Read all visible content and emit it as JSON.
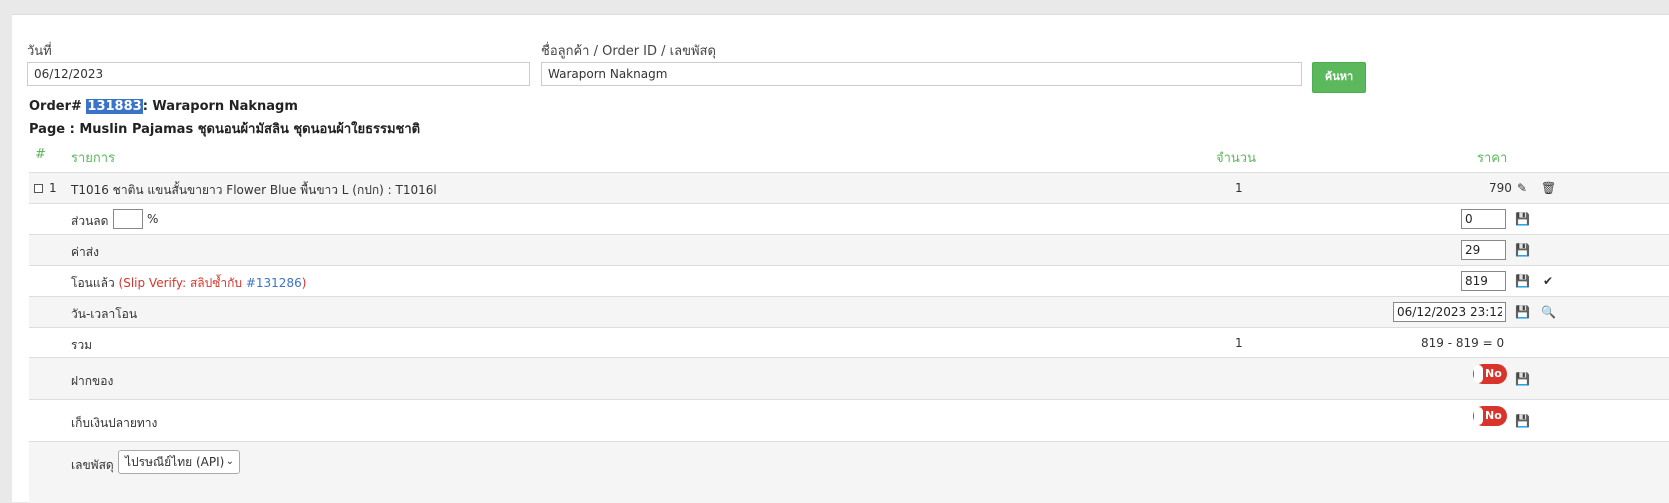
{
  "search": {
    "date_label": "วันที่",
    "date_value": "06/12/2023",
    "customer_label": "ชื่อลูกค้า / Order ID / เลขพัสดุ",
    "customer_value": "Waraporn Naknagm",
    "search_button": "ค้นหา"
  },
  "order": {
    "prefix": "Order#",
    "id": "131883",
    "customer": ": Waraporn Naknagm",
    "page_line": "Page : Muslin Pajamas ชุดนอนผ้ามัสลิน ชุดนอนผ้าใยธรรมชาติ"
  },
  "table": {
    "headers": {
      "num": "#",
      "item": "รายการ",
      "qty": "จำนวน",
      "price": "ราคา"
    },
    "item": {
      "num": "1",
      "name": "T1016 ชาติน แขนสั้นขายาว Flower Blue พื้นขาว L (กปก) : T1016l",
      "qty": "1",
      "price": "790"
    },
    "discount": {
      "label": "ส่วนลด",
      "percent_value": "",
      "percent_sign": "%",
      "value": "0"
    },
    "shipping": {
      "label": "ค่าส่ง",
      "value": "29"
    },
    "transferred": {
      "label": "โอนแล้ว",
      "verify_open": "(Slip Verify: สลิปซ้ำกับ",
      "verify_ref": "#131286",
      "verify_close": ")",
      "value": "819"
    },
    "transfer_time": {
      "label": "วัน-เวลาโอน",
      "value": "06/12/2023 23:12"
    },
    "total": {
      "label": "รวม",
      "qty": "1",
      "calc": "819 - 819 = 0"
    },
    "deposit": {
      "label": "ฝากของ",
      "toggle": "No"
    },
    "cod": {
      "label": "เก็บเงินปลายทาง",
      "toggle": "No"
    },
    "tracking": {
      "label": "เลขพัสดุ",
      "carrier": "ไปรษณีย์ไทย (API)"
    }
  },
  "icons": {
    "edit": "pencil-icon",
    "delete": "trash-icon",
    "save": "floppy-icon",
    "check": "check-icon",
    "search": "search-icon",
    "caret": "chevron-down-icon"
  },
  "colors": {
    "accent_green": "#5cb85c",
    "toggle_red": "#d9342b",
    "link_blue": "#3b73c8",
    "verify_red": "#d9342b"
  }
}
